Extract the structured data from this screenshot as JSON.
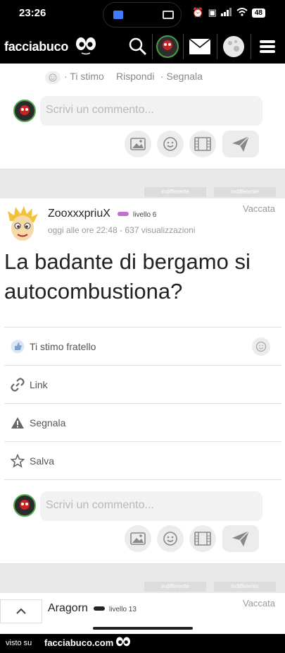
{
  "status_bar": {
    "time": "23:26",
    "battery": "48"
  },
  "header": {
    "brand": "facciabuco",
    "icons": [
      "search-icon",
      "avatar",
      "mail-icon",
      "moon-icon",
      "menu-icon"
    ]
  },
  "prev_post": {
    "actions": [
      "· Ti stimo",
      "Rispondi",
      "· Segnala"
    ],
    "comment_placeholder": "Scrivi un commento..."
  },
  "tag_pills": [
    "indifferente",
    "indifferente"
  ],
  "post": {
    "username": "ZooxxxpriuX",
    "level": "livello 6",
    "level_color": "#c56bd6",
    "meta": "oggi alle ore 22:48 - 637 visualizzazioni",
    "vaccata": "Vaccata",
    "title": "La badante di bergamo si autocombustiona?",
    "actions": {
      "like": "Ti stimo fratello",
      "link": "Link",
      "report": "Segnala",
      "save": "Salva"
    },
    "comment_placeholder": "Scrivi un commento..."
  },
  "next_post": {
    "username": "Aragorn",
    "level": "livello 13",
    "level_color": "#222222",
    "vaccata": "Vaccata"
  },
  "footer": {
    "visto": "visto su",
    "brand": "facciabuco.com"
  }
}
